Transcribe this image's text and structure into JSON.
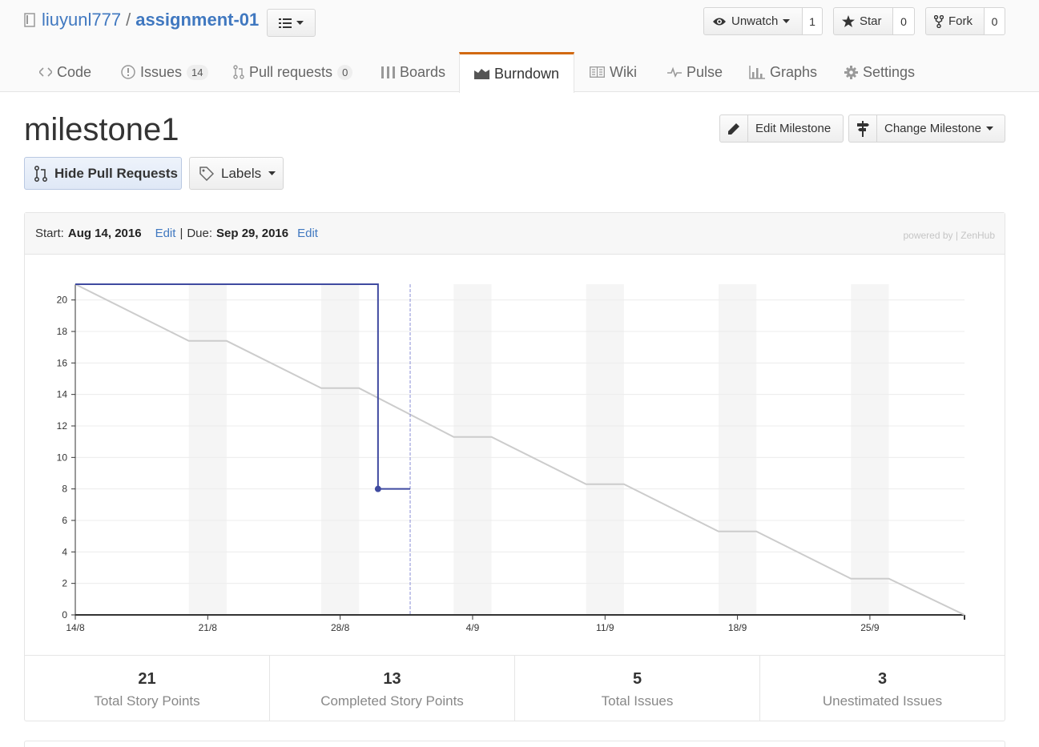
{
  "repo": {
    "owner": "liuyunl777",
    "separator": "/",
    "name": "assignment-01"
  },
  "actions": {
    "watch": {
      "label": "Unwatch",
      "count": "1"
    },
    "star": {
      "label": "Star",
      "count": "0"
    },
    "fork": {
      "label": "Fork",
      "count": "0"
    }
  },
  "tabs": [
    {
      "label": "Code",
      "icon": "code-icon"
    },
    {
      "label": "Issues",
      "count": "14",
      "icon": "issue-icon"
    },
    {
      "label": "Pull requests",
      "count": "0",
      "icon": "pull-request-icon"
    },
    {
      "label": "Boards",
      "icon": "boards-icon"
    },
    {
      "label": "Burndown",
      "icon": "burndown-icon",
      "selected": true
    },
    {
      "label": "Wiki",
      "icon": "wiki-icon"
    },
    {
      "label": "Pulse",
      "icon": "pulse-icon"
    },
    {
      "label": "Graphs",
      "icon": "graph-icon"
    },
    {
      "label": "Settings",
      "icon": "gear-icon"
    }
  ],
  "milestone": {
    "title": "milestone1",
    "edit_label": "Edit Milestone",
    "change_label": "Change Milestone",
    "hide_pr_label": "Hide Pull Requests",
    "labels_label": "Labels"
  },
  "panel": {
    "start_label": "Start:",
    "start_date": "Aug 14, 2016",
    "edit1": "Edit",
    "divider": "|",
    "due_label": "Due:",
    "due_date": "Sep 29, 2016",
    "edit2": "Edit",
    "powered": "powered by | ZenHub"
  },
  "stats": [
    {
      "value": "21",
      "label": "Total Story Points"
    },
    {
      "value": "13",
      "label": "Completed Story Points"
    },
    {
      "value": "5",
      "label": "Total Issues"
    },
    {
      "value": "3",
      "label": "Unestimated Issues"
    }
  ],
  "colors": {
    "accent": "#d26911",
    "link": "#4078c0",
    "actual": "#3f4aa0",
    "ideal": "#cccccc"
  },
  "chart_data": {
    "type": "line",
    "x_ticks": [
      "14/8",
      "21/8",
      "28/8",
      "4/9",
      "11/9",
      "18/9",
      "25/9"
    ],
    "y_ticks": [
      0,
      2,
      4,
      6,
      8,
      10,
      12,
      14,
      16,
      18,
      20
    ],
    "ylim": [
      0,
      21
    ],
    "x_domain_days": [
      0,
      47
    ],
    "weekend_bands_days": [
      [
        6,
        8
      ],
      [
        13,
        15
      ],
      [
        20,
        22
      ],
      [
        27,
        29
      ],
      [
        34,
        36
      ],
      [
        41,
        43
      ]
    ],
    "today_day": 17.7,
    "series": [
      {
        "name": "",
        "points": [
          [
            0,
            21
          ],
          [
            6,
            17.4
          ],
          [
            8,
            17.4
          ],
          [
            13,
            14.4
          ],
          [
            15,
            14.4
          ],
          [
            20,
            11.3
          ],
          [
            22,
            11.3
          ],
          [
            27,
            8.3
          ],
          [
            29,
            8.3
          ],
          [
            34,
            5.3
          ],
          [
            36,
            5.3
          ],
          [
            41,
            2.3
          ],
          [
            43,
            2.3
          ],
          [
            47,
            0
          ]
        ]
      },
      {
        "name": "",
        "points": [
          [
            0,
            21
          ],
          [
            16,
            21
          ],
          [
            16,
            8
          ],
          [
            17.7,
            8
          ]
        ],
        "marker_day": 16
      }
    ]
  }
}
